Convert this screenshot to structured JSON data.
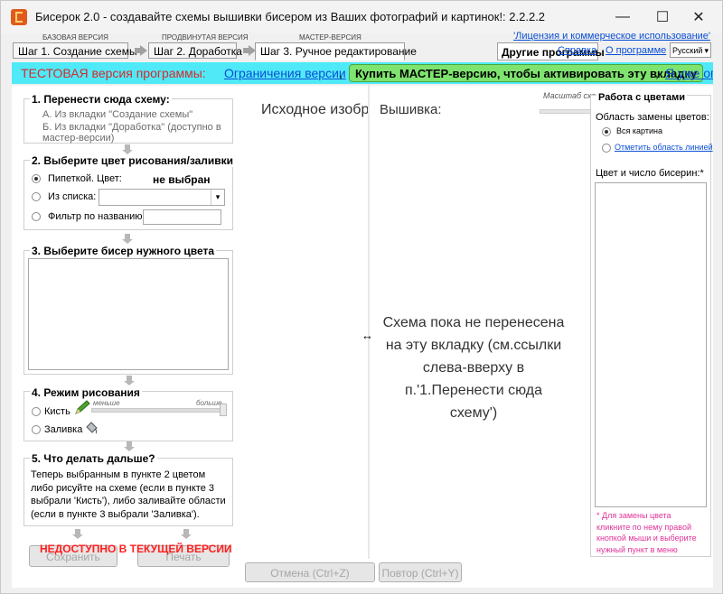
{
  "window": {
    "title": "Бисерок 2.0 - создавайте схемы вышивки бисером из Ваших фотографий и картинок!: 2.2.2.2",
    "minimize": "—",
    "maximize": "☐",
    "close": "✕"
  },
  "steps": [
    {
      "caption": "БАЗОВАЯ ВЕРСИЯ",
      "label": "Шаг 1. Создание схемы"
    },
    {
      "caption": "ПРОДВИНУТАЯ ВЕРСИЯ",
      "label": "Шаг 2. Доработка"
    },
    {
      "caption": "МАСТЕР-ВЕРСИЯ",
      "label": "Шаг 3. Ручное редактирование"
    }
  ],
  "header": {
    "license_link": "'Лицензия и коммерческое использование'",
    "other_programs": "Другие программы",
    "help": "Справка",
    "about": "О программе",
    "language": "Русский"
  },
  "testbar": {
    "test_version": "ТЕСТОВАЯ версия программы:",
    "limits_link": "Ограничения версии",
    "comma": ",",
    "buy_button": "Купить МАСТЕР-версию, чтобы активировать эту вкладку",
    "already_link": "Я уже оп"
  },
  "left": {
    "s1_title": "1. Перенести сюда схему:",
    "s1_a": "А. Из вкладки \"Создание схемы\"",
    "s1_b1": "Б. Из вкладки \"Доработка\" (доступно в",
    "s1_b2": "мастер-версии)",
    "s2_title": "2. Выберите цвет рисования/заливки",
    "pipette_label": "Пипеткой. Цвет:",
    "not_selected": "не выбран",
    "from_list_label": "Из списка:",
    "filter_label": "Фильтр по названию:",
    "s3_title": "3. Выберите бисер нужного цвета",
    "s4_title": "4. Режим рисования",
    "smaller": "меньше",
    "bigger": "больше",
    "brush": "Кисть",
    "fill": "Заливка",
    "s5_title": "5. Что делать дальше?",
    "s5_lines": [
      "Теперь выбранным в пункте 2 цветом",
      "либо рисуйте на схеме (если в пункте 3",
      "выбрали 'Кисть'), либо заливайте области",
      "(если в пункте 3 выбрали 'Заливка')."
    ],
    "unavailable": "НЕДОСТУПНО В ТЕКУЩЕЙ ВЕРСИИ",
    "save": "Сохранить",
    "print": "Печать"
  },
  "center": {
    "original_label": "Исходное изобр",
    "embroidery_label": "Вышивка:",
    "scale_label": "Масштаб схемы",
    "message": [
      "Схема пока не перенесена",
      "на эту вкладку (см.ссылки",
      "слева-вверху в",
      "п.'1.Перенести сюда",
      "схему')"
    ],
    "undo": "Отмена (Ctrl+Z)",
    "redo": "Повтор (Ctrl+Y)"
  },
  "right": {
    "title": "Работа с цветами",
    "area_label": "Область замены цветов:",
    "whole": "Вся картина",
    "mark_link": "Отметить область линией",
    "colors_label": "Цвет и число бисерин:*",
    "note": [
      "* Для замены цвета",
      "кликните по нему правой",
      "кнопкой мыши и выберите",
      "нужный пункт в меню"
    ]
  }
}
